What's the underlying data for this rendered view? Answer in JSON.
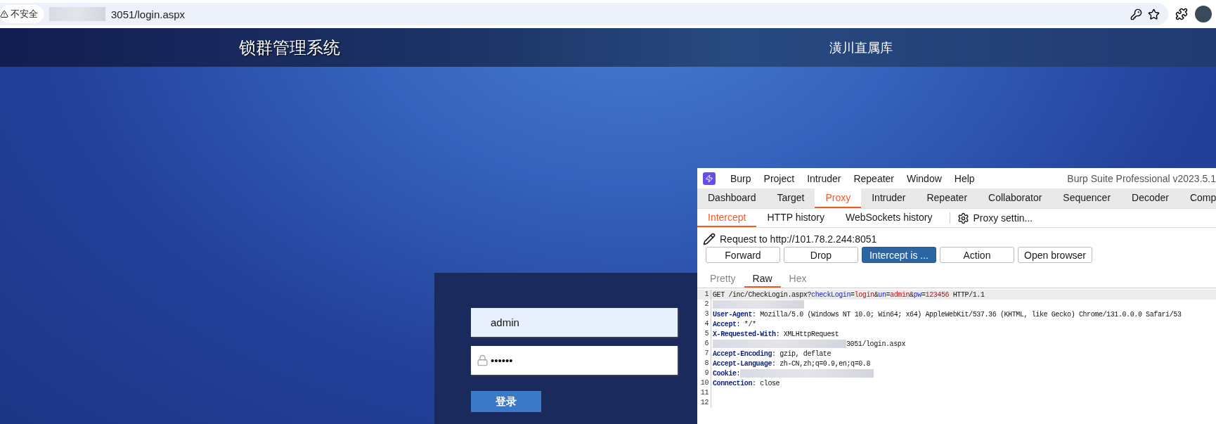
{
  "browser": {
    "security_label": "不安全",
    "url": {
      "redacted": true,
      "text": "3051/login.aspx"
    }
  },
  "header": {
    "title": "锁群管理系统",
    "subtitle": "潢川直属库"
  },
  "login": {
    "username": "admin",
    "password": "••••••",
    "button": "登录"
  },
  "burp": {
    "menu": [
      "Burp",
      "Project",
      "Intruder",
      "Repeater",
      "Window",
      "Help"
    ],
    "title": "Burp Suite Professional v2023.5.1",
    "tabs": [
      {
        "label": "Dashboard",
        "selected": false
      },
      {
        "label": "Target",
        "selected": false
      },
      {
        "label": "Proxy",
        "selected": true
      },
      {
        "label": "Intruder",
        "selected": false
      },
      {
        "label": "Repeater",
        "selected": false
      },
      {
        "label": "Collaborator",
        "selected": false
      },
      {
        "label": "Sequencer",
        "selected": false
      },
      {
        "label": "Decoder",
        "selected": false
      },
      {
        "label": "Comp",
        "selected": false
      }
    ],
    "subtabs": [
      {
        "label": "Intercept",
        "selected": true
      },
      {
        "label": "HTTP history",
        "selected": false
      },
      {
        "label": "WebSockets history",
        "selected": false
      }
    ],
    "settings_label": "Proxy settin...",
    "request_to": "Request to http://101.78.2.244:8051",
    "buttons": [
      {
        "label": "Forward",
        "on": false
      },
      {
        "label": "Drop",
        "on": false
      },
      {
        "label": "Intercept is ...",
        "on": true
      },
      {
        "label": "Action",
        "on": false
      },
      {
        "label": "Open browser",
        "on": false
      }
    ],
    "editor_tabs": [
      {
        "label": "Pretty",
        "selected": false
      },
      {
        "label": "Raw",
        "selected": true
      },
      {
        "label": "Hex",
        "selected": false
      }
    ],
    "lines": [
      {
        "number": "1",
        "current": true,
        "segments": [
          {
            "kind": "plain",
            "text": "GET /inc/CheckLogin.aspx?"
          },
          {
            "kind": "param",
            "text": "checkLogin"
          },
          {
            "kind": "plain",
            "text": "="
          },
          {
            "kind": "value",
            "text": "login"
          },
          {
            "kind": "plain",
            "text": "&"
          },
          {
            "kind": "param",
            "text": "un"
          },
          {
            "kind": "plain",
            "text": "="
          },
          {
            "kind": "value",
            "text": "admin"
          },
          {
            "kind": "plain",
            "text": "&"
          },
          {
            "kind": "param",
            "text": "pw"
          },
          {
            "kind": "plain",
            "text": "="
          },
          {
            "kind": "value",
            "text": "123456"
          },
          {
            "kind": "plain",
            "text": " HTTP/1.1"
          }
        ]
      },
      {
        "number": "2",
        "current": false,
        "segments": [
          {
            "kind": "redacted"
          }
        ]
      },
      {
        "number": "3",
        "current": false,
        "segments": [
          {
            "kind": "name",
            "text": "User-Agent"
          },
          {
            "kind": "plain",
            "text": ": Mozilla/5.0 (Windows NT 10.0; Win64; x64) AppleWebKit/537.36 (KHTML, like Gecko) Chrome/131.0.0.0 Safari/53"
          }
        ]
      },
      {
        "number": "4",
        "current": false,
        "segments": [
          {
            "kind": "name",
            "text": "Accept"
          },
          {
            "kind": "plain",
            "text": ": */*"
          }
        ]
      },
      {
        "number": "5",
        "current": false,
        "segments": [
          {
            "kind": "name",
            "text": "X-Requested-With"
          },
          {
            "kind": "plain",
            "text": ": XMLHttpRequest"
          }
        ]
      },
      {
        "number": "6",
        "current": false,
        "segments": [
          {
            "kind": "redacted-long"
          },
          {
            "kind": "plain",
            "text": "3051/login.aspx"
          }
        ]
      },
      {
        "number": "7",
        "current": false,
        "segments": [
          {
            "kind": "name",
            "text": "Accept-Encoding"
          },
          {
            "kind": "plain",
            "text": ": gzip, deflate"
          }
        ]
      },
      {
        "number": "8",
        "current": false,
        "segments": [
          {
            "kind": "name",
            "text": "Accept-Language"
          },
          {
            "kind": "plain",
            "text": ": zh-CN,zh;q=0.9,en;q=0.8"
          }
        ]
      },
      {
        "number": "9",
        "current": false,
        "segments": [
          {
            "kind": "name",
            "text": "Cookie"
          },
          {
            "kind": "plain",
            "text": ":"
          },
          {
            "kind": "redacted-long"
          }
        ]
      },
      {
        "number": "10",
        "current": false,
        "segments": [
          {
            "kind": "name",
            "text": "Connection"
          },
          {
            "kind": "plain",
            "text": ": close"
          }
        ]
      },
      {
        "number": "11",
        "current": false
      },
      {
        "number": "12",
        "current": false
      }
    ]
  }
}
